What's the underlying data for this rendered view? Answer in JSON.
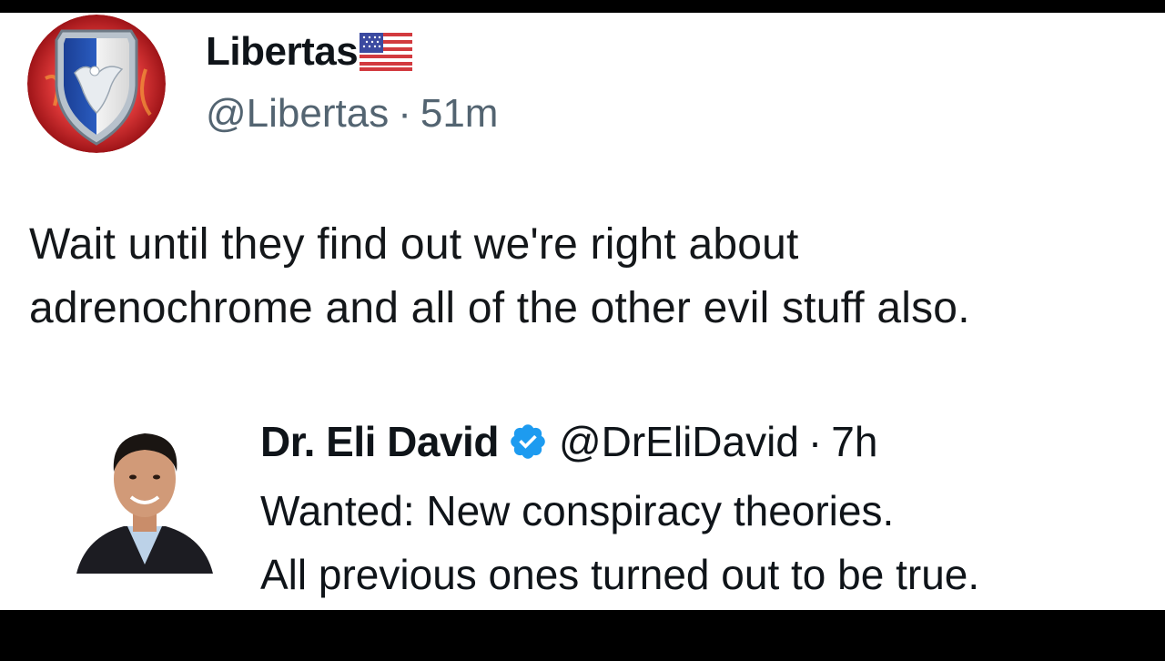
{
  "tweet": {
    "author": {
      "display_name": "Libertas",
      "name_emoji": "us-flag-icon",
      "handle": "@Libertas",
      "separator": "·",
      "time": "51m",
      "avatar": "eagle-shield-avatar"
    },
    "text_lines": [
      "Wait until they find out we're right about",
      "adrenochrome and all of the other evil stuff also."
    ]
  },
  "quoted_tweet": {
    "author": {
      "display_name": "Dr. Eli David",
      "verified": true,
      "handle": "@DrEliDavid",
      "separator": "·",
      "time": "7h",
      "avatar": "person-photo-avatar"
    },
    "text_lines": [
      "Wanted: New conspiracy theories.",
      "All previous ones turned out to be true."
    ]
  },
  "colors": {
    "background": "#ffffff",
    "letterbox": "#000000",
    "muted_text": "#536471",
    "verified_blue": "#1d9bf0",
    "avatar_ring_red": "#c8202a",
    "shield_blue": "#1f4fa8"
  }
}
